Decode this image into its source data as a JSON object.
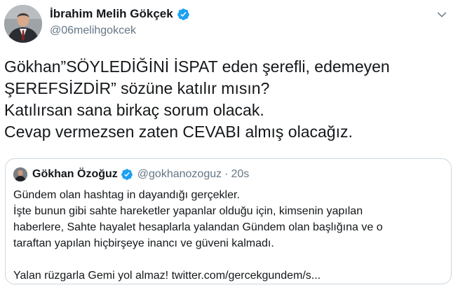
{
  "author": {
    "name": "İbrahim Melih Gökçek",
    "handle": "@06melihgokcek",
    "verified": true,
    "avatar_icon": "user-avatar"
  },
  "menu": {
    "icon": "chevron-down-icon"
  },
  "tweet": {
    "lines": [
      "Gökhan”SÖYLEDİĞİNİ İSPAT eden şerefli, edemeyen",
      "ŞEREFSİZDİR” sözüne katılır mısın?",
      "Katılırsan sana birkaç sorum olacak.",
      "Cevap vermezsen zaten CEVABI almış olacağız."
    ]
  },
  "quoted": {
    "name": "Gökhan Özoğuz",
    "handle": "@gokhanozoguz",
    "separator": "·",
    "time": "20s",
    "verified": true,
    "lines": [
      "Gündem olan hashtag in dayandığı gerçekler.",
      "İşte bunun gibi sahte hareketler yapanlar olduğu için, kimsenin yapılan",
      "haberlere, Sahte hayalet hesaplarla yalandan Gündem olan başlığına ve o",
      "taraftan yapılan hiçbirşeye inancı ve güveni kalmadı.",
      "",
      "Yalan rüzgarla Gemi yol almaz! twitter.com/gercekgundem/s..."
    ]
  },
  "colors": {
    "text": "#14171a",
    "secondary": "#657786",
    "verified": "#1da1f2",
    "border": "#ccd6dd"
  }
}
